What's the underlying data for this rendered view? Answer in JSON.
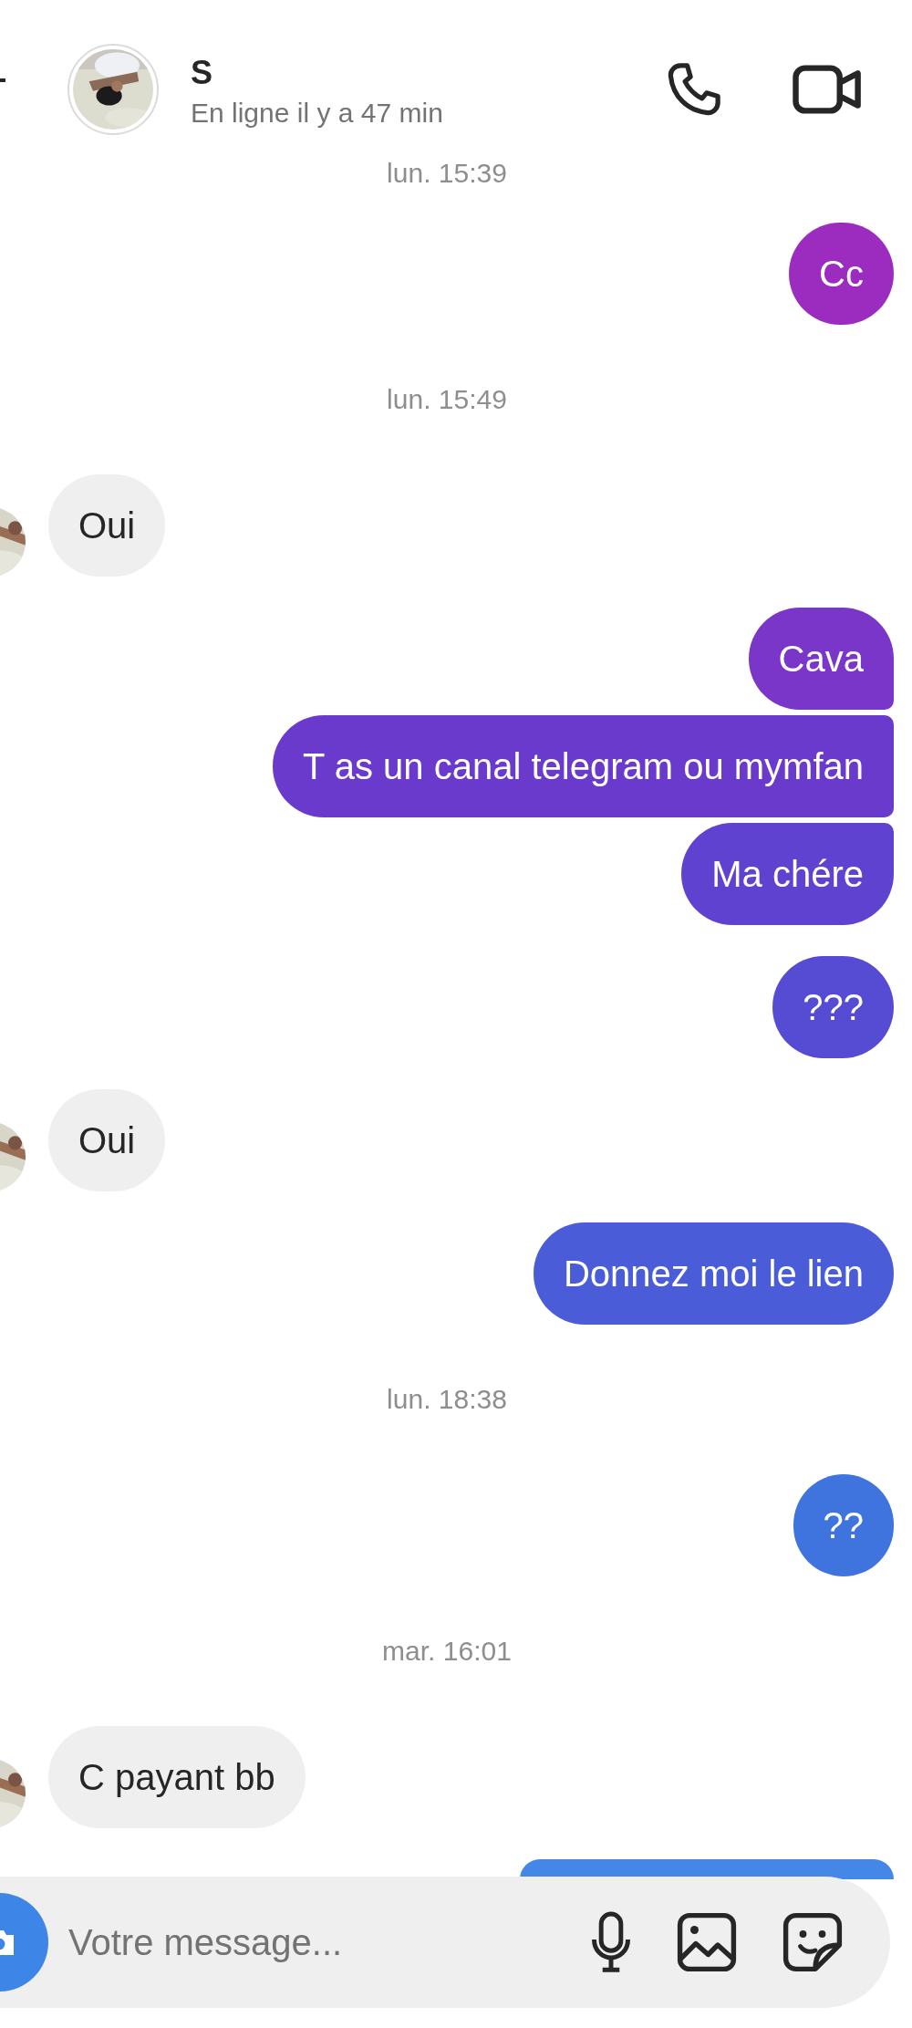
{
  "header": {
    "name": "S",
    "status": "En ligne il y a 47 min"
  },
  "thread": [
    {
      "kind": "timestamp",
      "text": "lun. 15:39"
    },
    {
      "kind": "outgoing",
      "messages": [
        {
          "text": "Cc",
          "color": "#9c2bbf"
        }
      ]
    },
    {
      "kind": "timestamp",
      "text": "lun. 15:49"
    },
    {
      "kind": "incoming",
      "messages": [
        {
          "text": "Oui"
        }
      ]
    },
    {
      "kind": "outgoing",
      "messages": [
        {
          "text": "Cava",
          "color": "#7a35c9"
        },
        {
          "text": "T as un canal telegram ou mymfan",
          "color": "#6a3acc"
        },
        {
          "text": "Ma chére",
          "color": "#5f42cf"
        }
      ]
    },
    {
      "kind": "outgoing",
      "messages": [
        {
          "text": "???",
          "color": "#564bd3"
        }
      ]
    },
    {
      "kind": "incoming",
      "messages": [
        {
          "text": "Oui"
        }
      ]
    },
    {
      "kind": "outgoing",
      "messages": [
        {
          "text": "Donnez moi le lien",
          "color": "#4a5cd8"
        }
      ]
    },
    {
      "kind": "timestamp",
      "text": "lun. 18:38"
    },
    {
      "kind": "outgoing",
      "messages": [
        {
          "text": "??",
          "color": "#3f74df"
        }
      ]
    },
    {
      "kind": "timestamp",
      "text": "mar. 16:01"
    },
    {
      "kind": "incoming",
      "messages": [
        {
          "text": "C payant bb"
        }
      ]
    },
    {
      "kind": "outgoing",
      "messages": [
        {
          "color": "#4487e6"
        }
      ]
    }
  ],
  "composer": {
    "placeholder": "Votre message..."
  }
}
